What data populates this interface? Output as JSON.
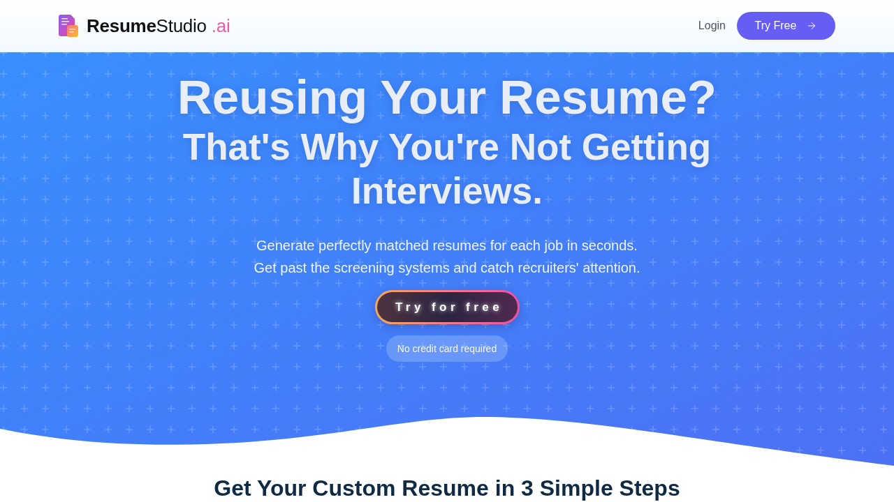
{
  "header": {
    "logo": {
      "bold": "Resume",
      "regular": "Studio",
      "suffix": ".ai"
    },
    "nav": [
      {
        "kind": "link",
        "label": "Login"
      },
      {
        "kind": "button",
        "label": "Try Free"
      }
    ]
  },
  "hero": {
    "title": "Reusing Your Resume?",
    "subtitle": "That's Why You're Not Getting Interviews.",
    "description": [
      "Generate perfectly matched resumes for each job in seconds.",
      "Get past the screening systems and catch recruiters' attention."
    ],
    "cta": "Try for free",
    "note": "No credit card required"
  },
  "next_section": {
    "heading": "Get Your Custom Resume in 3 Simple Steps"
  }
}
